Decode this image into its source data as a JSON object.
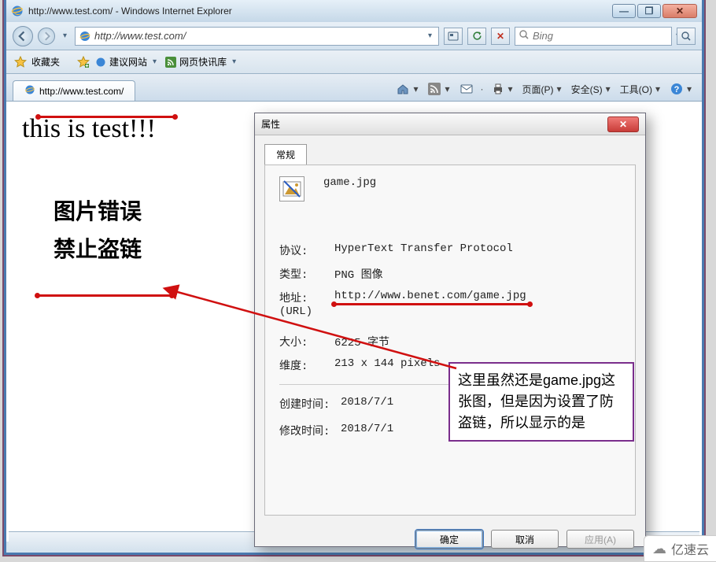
{
  "window": {
    "title": "http://www.test.com/ - Windows Internet Explorer"
  },
  "nav": {
    "url": "http://www.test.com/",
    "search_placeholder": "Bing"
  },
  "favbar": {
    "favorites": "收藏夹",
    "suggest": "建议网站",
    "quick": "网页快讯库"
  },
  "tab": {
    "label": "http://www.test.com/"
  },
  "toolbar": {
    "page": "页面(P)",
    "safe": "安全(S)",
    "tools": "工具(O)"
  },
  "page": {
    "heading": "this is test!!!",
    "err1": "图片错误",
    "err2": "禁止盗链"
  },
  "dialog": {
    "title": "属性",
    "tab": "常规",
    "filename": "game.jpg",
    "rows": {
      "protocol_label": "协议:",
      "protocol_value": "HyperText Transfer Protocol",
      "type_label": "类型:",
      "type_value": "PNG 图像",
      "url_label": "地址:\n(URL)",
      "url_value": "http://www.benet.com/game.jpg",
      "size_label": "大小:",
      "size_value": "6225 字节",
      "dim_label": "维度:",
      "dim_value": "213 x 144 pixels",
      "ctime_label": "创建时间:",
      "ctime_value": "2018/7/1",
      "mtime_label": "修改时间:",
      "mtime_value": "2018/7/1"
    },
    "buttons": {
      "ok": "确定",
      "cancel": "取消",
      "apply": "应用(A)"
    }
  },
  "annotation": {
    "text": "这里虽然还是game.jpg这张图，但是因为设置了防盗链，所以显示的是"
  },
  "watermark": "亿速云"
}
